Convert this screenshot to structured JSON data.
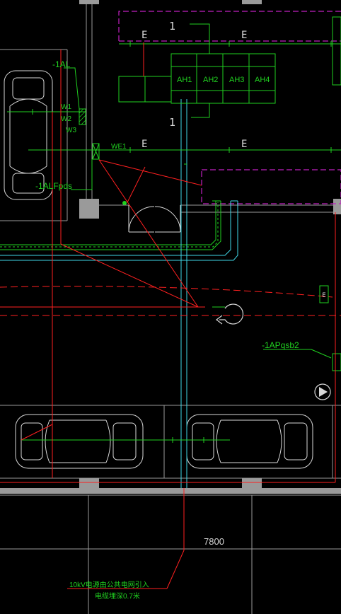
{
  "colors": {
    "background": "#000000",
    "wall": "#9a9a9a",
    "power_line": "#ff2020",
    "green": "#20d020",
    "cyan": "#40d8e8",
    "magenta": "#c020c0",
    "white": "#d8d8d8"
  },
  "labels": {
    "dist_box_1al": "-1AL",
    "dist_box_1alfpds": "-1ALFpds",
    "dist_box_1apqsb2": "-1APqsb2",
    "circuit_w1": "W1",
    "circuit_w2": "W2",
    "circuit_w3": "W3",
    "circuit_we1": "WE1",
    "marker_e": "E",
    "marker_1": "1",
    "cabinet_ah1": "AH1",
    "cabinet_ah2": "AH2",
    "cabinet_ah3": "AH3",
    "cabinet_ah4": "AH4",
    "dimension_7800": "7800",
    "cable_note_line1": "10kV电源由公共电网引入",
    "cable_note_line2": "电缆埋深0.7米"
  },
  "icons": {
    "exit_sign": "exit-sign-icon",
    "direction_arrow": "u-turn-arrow-icon",
    "play_circle": "fire-pump-circle-icon"
  }
}
